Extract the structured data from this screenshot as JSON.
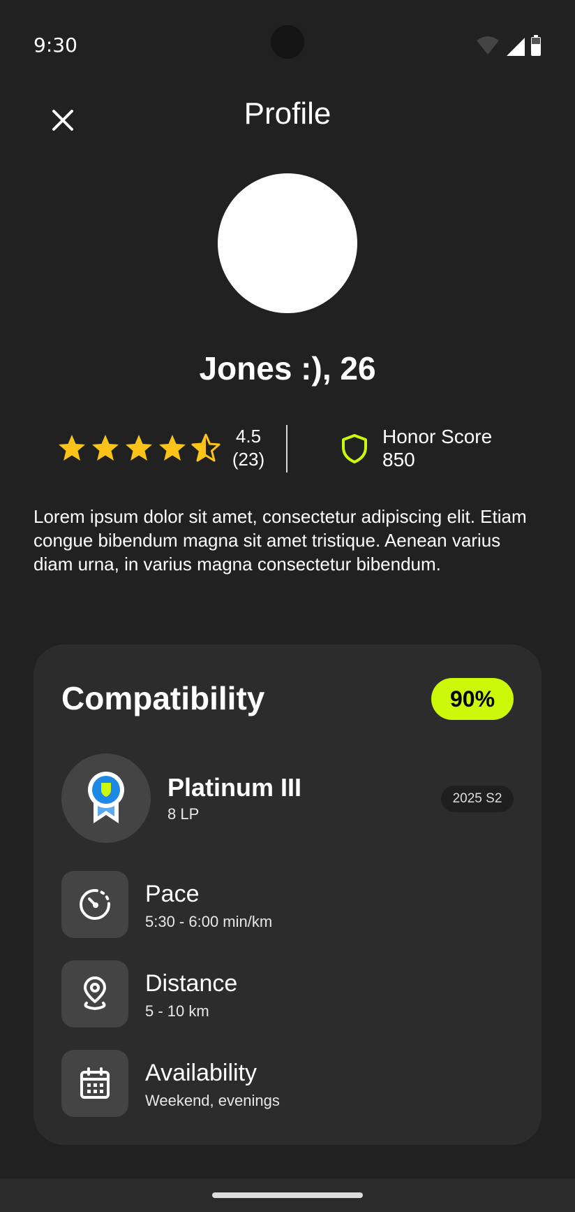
{
  "status_bar": {
    "time": "9:30"
  },
  "header": {
    "title": "Profile"
  },
  "profile": {
    "name": "Jones :), 26"
  },
  "rating": {
    "value": "4.5",
    "count": "(23)",
    "stars": 4.5,
    "max_stars": 5
  },
  "honor": {
    "label": "Honor Score",
    "value": "850"
  },
  "bio": "Lorem ipsum dolor sit amet, consectetur adipiscing elit. Etiam congue bibendum magna sit amet tristique. Aenean varius diam urna, in varius magna consectetur bibendum.",
  "compatibility": {
    "title": "Compatibility",
    "percent": "90%",
    "rank": {
      "title": "Platinum III",
      "lp": "8 LP",
      "season": "2025 S2"
    },
    "preferences": [
      {
        "icon": "speedometer-icon",
        "label": "Pace",
        "value": "5:30 - 6:00 min/km"
      },
      {
        "icon": "location-pin-icon",
        "label": "Distance",
        "value": "5 - 10 km"
      },
      {
        "icon": "calendar-icon",
        "label": "Availability",
        "value": "Weekend, evenings"
      }
    ]
  },
  "colors": {
    "background": "#212121",
    "card": "#2c2c2c",
    "accent": "#ccf80a",
    "star": "#fcc419",
    "medal_blue": "#1e88e5"
  }
}
